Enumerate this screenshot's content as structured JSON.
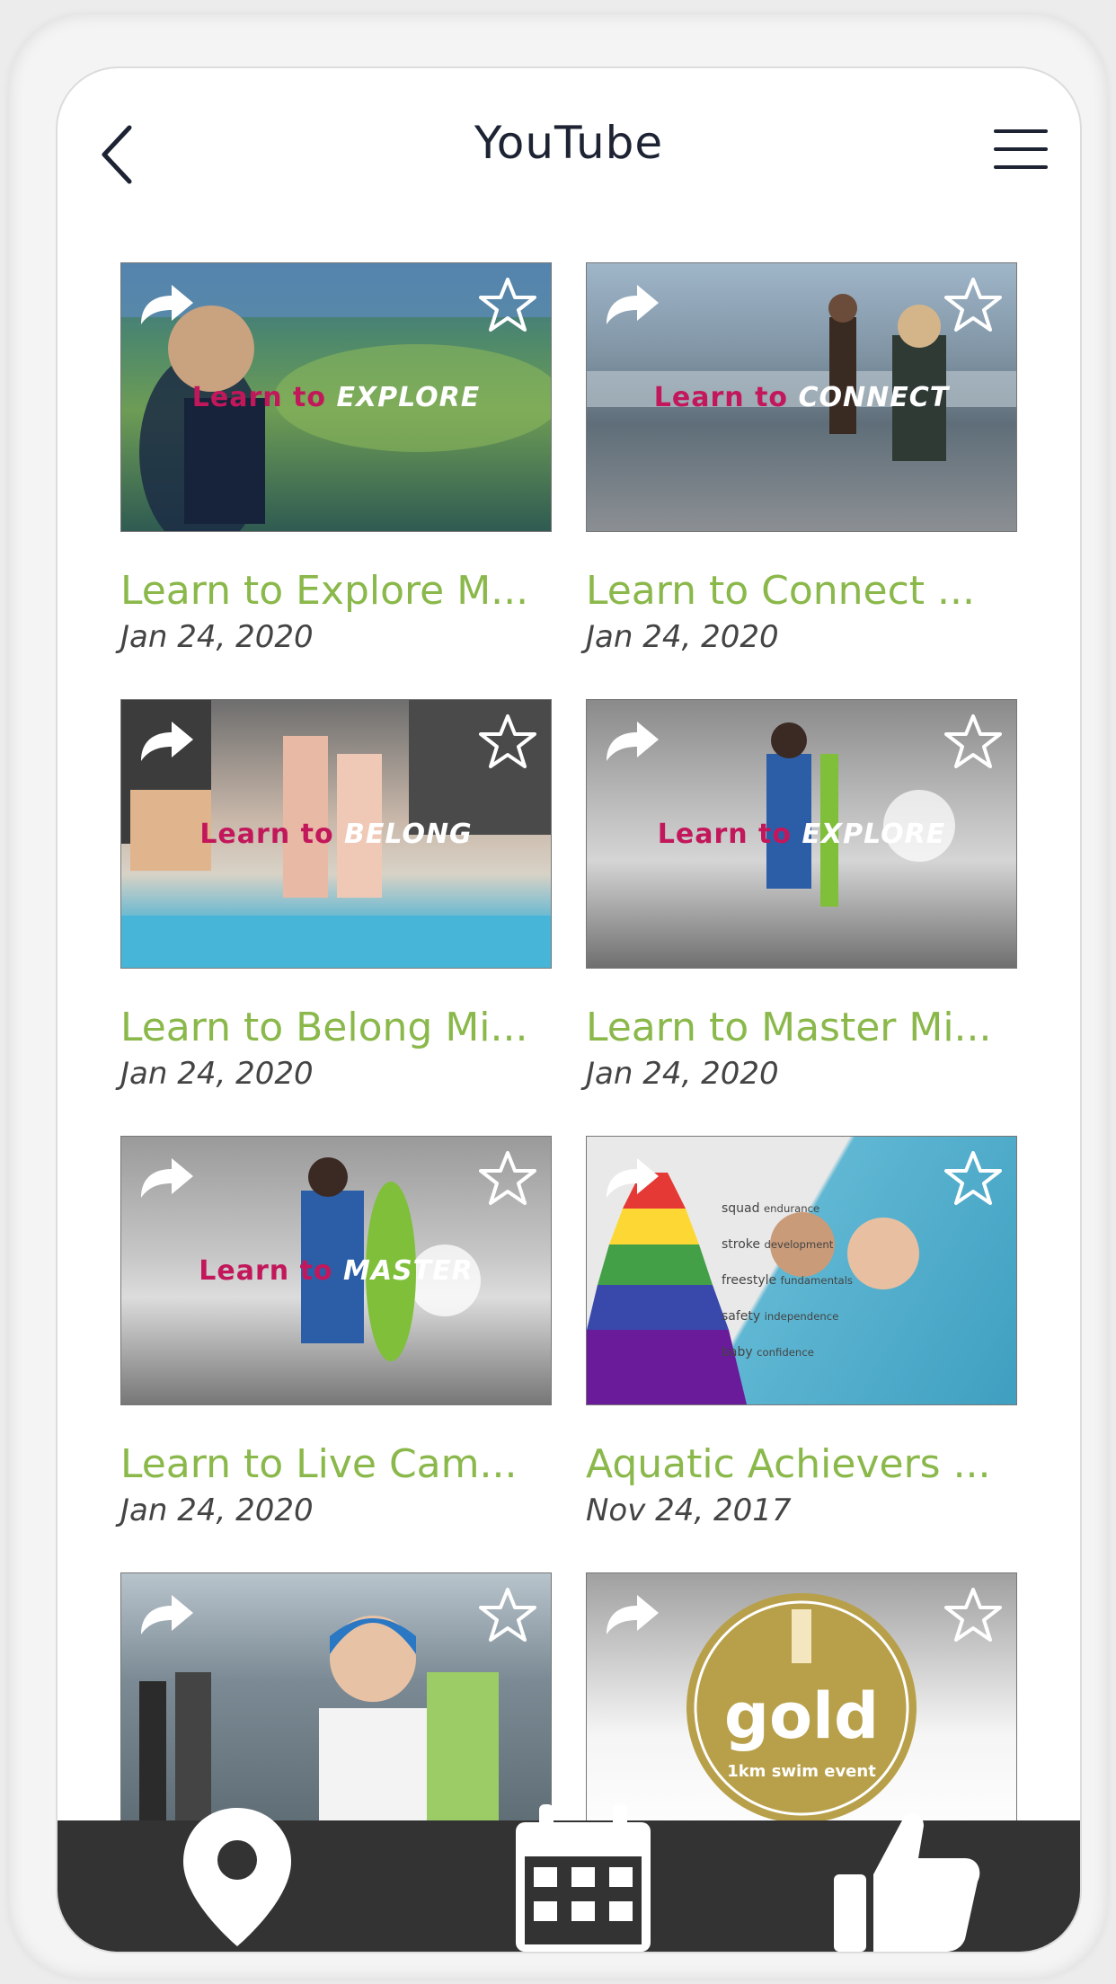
{
  "header": {
    "title": "YouTube"
  },
  "videos": [
    {
      "title": "Learn to Explore M...",
      "date": "Jan 24, 2020",
      "overlay_a": "Learn to",
      "overlay_b": "EXPLORE"
    },
    {
      "title": "Learn to Connect ...",
      "date": "Jan 24, 2020",
      "overlay_a": "Learn to",
      "overlay_b": "CONNECT"
    },
    {
      "title": "Learn to Belong Mi...",
      "date": "Jan 24, 2020",
      "overlay_a": "Learn to",
      "overlay_b": "BELONG"
    },
    {
      "title": "Learn to Master Mi...",
      "date": "Jan 24, 2020",
      "overlay_a": "Learn to",
      "overlay_b": "EXPLORE"
    },
    {
      "title": "Learn to Live Cam...",
      "date": "Jan 24, 2020",
      "overlay_a": "Learn to",
      "overlay_b": "MASTER"
    },
    {
      "title": "Aquatic Achievers ...",
      "date": "Nov 24, 2017"
    },
    {
      "title": "",
      "date": ""
    },
    {
      "title": "",
      "date": "",
      "badge_main": "gold",
      "badge_sub": "1km swim event"
    }
  ],
  "pyramid_labels": [
    "squad",
    "stroke",
    "freestyle",
    "safety",
    "baby"
  ],
  "pyramid_sublabels": [
    "endurance",
    "development",
    "fundamentals",
    "independence",
    "confidence"
  ],
  "bottom_nav": {
    "items": [
      {
        "icon": "location-pin-icon"
      },
      {
        "icon": "calendar-icon"
      },
      {
        "icon": "thumbs-up-icon"
      }
    ]
  },
  "colors": {
    "title_green": "#8ab84a",
    "header_text": "#1d2333",
    "bottom_bar": "#333333",
    "overlay_pink": "#c2185b"
  }
}
